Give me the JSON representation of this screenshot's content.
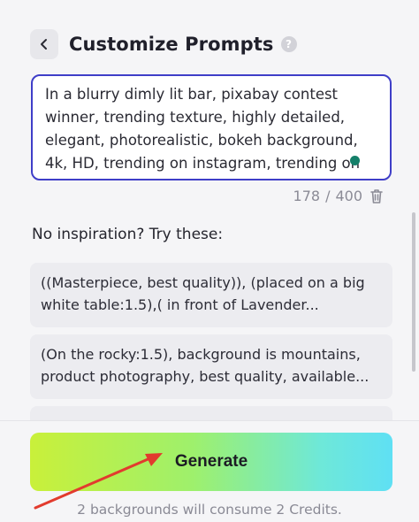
{
  "header": {
    "title": "Customize Prompts",
    "help_glyph": "?"
  },
  "prompt": {
    "text": "In a blurry dimly lit bar, pixabay contest winner, trending texture, highly detailed, elegant, photorealistic, bokeh background, 4k, HD, trending on instagram, trending on",
    "char_count": "178",
    "char_limit": "400",
    "separator": "/"
  },
  "inspiration": {
    "heading": "No inspiration? Try these:",
    "suggestions": [
      "((Masterpiece, best quality)), (placed on a big white table:1.5),( in front of Lavender...",
      "(On the rocky:1.5), background is mountains, product photography, best quality, available..."
    ]
  },
  "footer": {
    "generate_label": "Generate",
    "credits_note": "2 backgrounds will consume 2 Credits."
  },
  "colors": {
    "accent_border": "#3f3ec8",
    "grammar_dot": "#15806a",
    "annotation_arrow": "#e23b2e",
    "button_gradient_start": "#c9f03a",
    "button_gradient_end": "#5fe0f4"
  },
  "icons": {
    "back": "chevron-left-icon",
    "help": "question-circle-icon",
    "delete": "trash-icon"
  }
}
